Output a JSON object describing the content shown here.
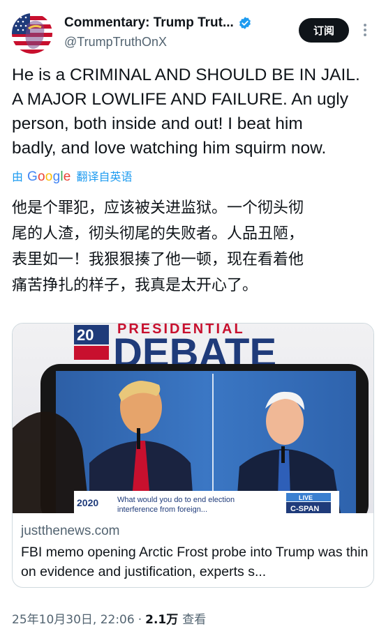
{
  "author": {
    "display_name": "Commentary: Trump Trut...",
    "handle": "@TrumpTruthOnX",
    "verified": true,
    "avatar_icon": "trump-flag-avatar"
  },
  "actions": {
    "subscribe_label": "订阅",
    "more_icon": "more-vertical-icon"
  },
  "tweet": {
    "text_lines": [
      "He is a CRIMINAL AND SHOULD BE IN JAIL.",
      "A MAJOR LOWLIFE AND FAILURE. An ugly",
      "person, both inside and out! I beat him",
      "badly, and love watching him squirm now."
    ],
    "translation": {
      "by": "由",
      "provider": "Google",
      "label": "翻译自英语"
    },
    "translated_lines": [
      "他是个罪犯，应该被关进监狱。一个彻头彻",
      "尾的人渣，彻头彻尾的失败者。人品丑陋，",
      "表里如一！我狠狠揍了他一顿，现在看着他",
      "痛苦挣扎的样子，我真是太开心了。"
    ]
  },
  "card": {
    "image_banner_text": "DEBATE",
    "image_banner_top": "PRESIDENTIAL",
    "image_year": "20",
    "image_chyron_text": "What would you do to end election",
    "image_chyron_text2": "interference from foreign...",
    "image_chyron_logo": "2020",
    "image_live_label": "LIVE",
    "image_network": "C-SPAN",
    "domain": "justthenews.com",
    "title": "FBI memo opening Arctic Frost probe into Trump was thin on evidence and justification, experts s..."
  },
  "meta": {
    "date": "25年10月30日, 22:06",
    "separator": "·",
    "views": "2.1万",
    "views_label": "查看"
  },
  "colors": {
    "accent": "#1d9bf0",
    "text": "#0f1419",
    "secondary": "#536471",
    "border": "#cfd9de"
  }
}
